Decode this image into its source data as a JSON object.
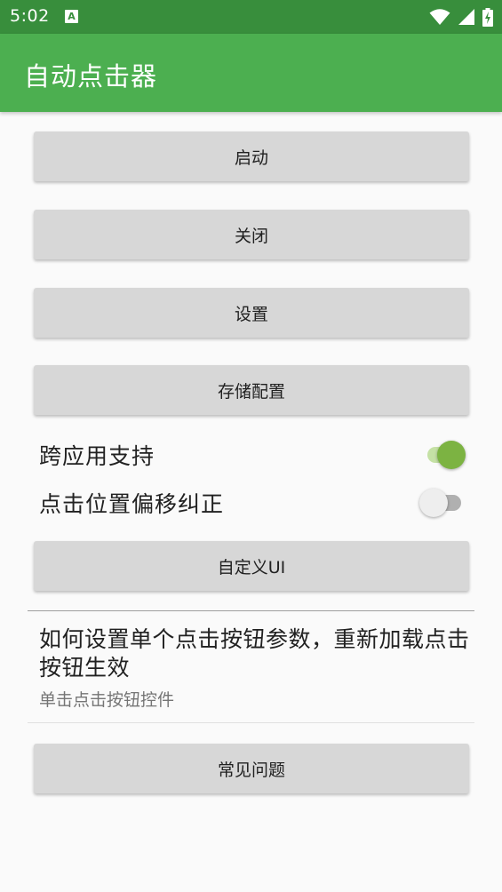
{
  "status_bar": {
    "time": "5:02",
    "notification_icon_letter": "A",
    "icons": [
      "wifi-icon",
      "signal-icon",
      "battery-charging-icon"
    ]
  },
  "app_bar": {
    "title": "自动点击器"
  },
  "buttons": {
    "start": "启动",
    "close": "关闭",
    "settings": "设置",
    "save_config": "存储配置",
    "custom_ui": "自定义UI",
    "faq": "常见问题"
  },
  "switches": [
    {
      "label": "跨应用支持",
      "on": true
    },
    {
      "label": "点击位置偏移纠正",
      "on": false
    }
  ],
  "help_item": {
    "title": "如何设置单个点击按钮参数，重新加载点击按钮生效",
    "subtitle": "单击点击按钮控件"
  },
  "colors": {
    "status_bar": "#388e3c",
    "app_bar": "#4caf50",
    "switch_on_thumb": "#7cb342",
    "switch_on_track": "#c5e1a5",
    "switch_off_thumb": "#eeeeee",
    "switch_off_track": "#b0b0b0",
    "button_bg": "#d7d7d7"
  }
}
